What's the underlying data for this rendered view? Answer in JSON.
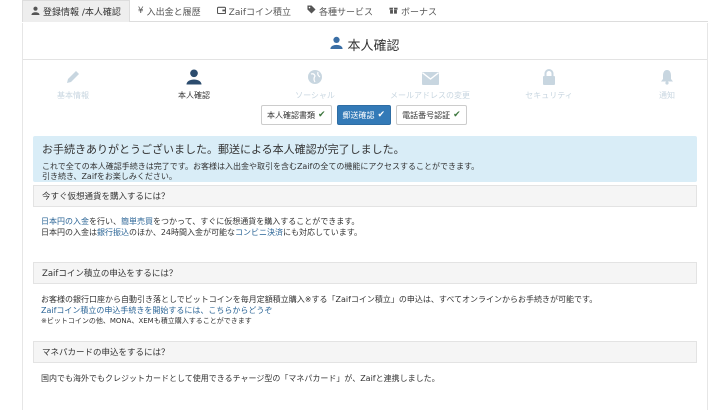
{
  "tabs": [
    {
      "label": "登録情報 /本人確認",
      "icon": "user-icon"
    },
    {
      "label": "入出金と履歴",
      "icon": "yen-icon"
    },
    {
      "label": "Zaifコイン積立",
      "icon": "wallet-icon"
    },
    {
      "label": "各種サービス",
      "icon": "tags-icon"
    },
    {
      "label": "ボーナス",
      "icon": "gift-icon"
    }
  ],
  "page_title": "本人確認",
  "steps": [
    {
      "label": "基本情報",
      "icon": "pencil-icon"
    },
    {
      "label": "本人確認",
      "icon": "user-icon"
    },
    {
      "label": "ソーシャル",
      "icon": "globe-icon"
    },
    {
      "label": "メールアドレスの変更",
      "icon": "envelope-icon"
    },
    {
      "label": "セキュリティ",
      "icon": "lock-icon"
    },
    {
      "label": "通知",
      "icon": "bell-icon"
    }
  ],
  "verification": {
    "documents_label": "本人確認書類",
    "postal_label": "郵送確認",
    "phone_label": "電話番号認証"
  },
  "alert": {
    "heading": "お手続きありがとうございました。郵送による本人確認が完了しました。",
    "line1": "これで全ての本人確認手続きは完了です。お客様は入出金や取引を含むZaifの全ての機能にアクセスすることができます。",
    "line2": "引き続き、Zaifをお楽しみください。"
  },
  "section1": {
    "heading": "今すぐ仮想通貨を購入するには？",
    "l1_link1": "日本円の入金",
    "l1_text1": "を行い、",
    "l1_link2": "簡単売買",
    "l1_text2": "をつかって、すぐに仮想通貨を購入することができます。",
    "l2_text1": "日本円の入金は",
    "l2_link1": "銀行振込",
    "l2_text2": "のほか、24時間入金が可能な",
    "l2_link2": "コンビニ決済",
    "l2_text3": "にも対応しています。"
  },
  "section2": {
    "heading": "Zaifコイン積立の申込をするには？",
    "line1": "お客様の銀行口座から自動引き落としでビットコインを毎月定額積立購入※する「Zaifコイン積立」の申込は、すべてオンラインからお手続きが可能です。",
    "line2_text": "Zaifコイン積立の申込手続きを開始するには、",
    "line2_link": "こちらからどうぞ",
    "note": "※ビットコインの他、MONA、XEMも積立購入することができます"
  },
  "section3": {
    "heading": "マネパカードの申込をするには？",
    "line1": "国内でも海外でもクレジットカードとして使用できるチャージ型の「マネパカード」が、Zaifと連携しました。"
  },
  "colors": {
    "link": "#2a6496",
    "alert_bg": "#d9edf7",
    "primary": "#337ab7",
    "step_inactive": "#c8d6e0",
    "step_active": "#2c4c6e"
  }
}
